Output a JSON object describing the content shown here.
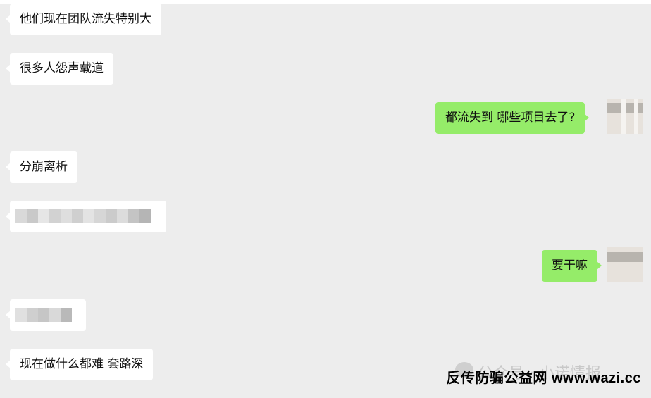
{
  "messages": [
    {
      "side": "left",
      "text": "他们现在团队流失特别大"
    },
    {
      "side": "left",
      "text": "很多人怨声载道"
    },
    {
      "side": "right",
      "text": "都流失到  哪些项目去了?"
    },
    {
      "side": "left",
      "text": "分崩离析"
    },
    {
      "side": "left",
      "text": "",
      "redacted": true
    },
    {
      "side": "right",
      "text": "要干嘛"
    },
    {
      "side": "left",
      "text": "",
      "redacted": true
    },
    {
      "side": "left",
      "text": "现在做什么都难 套路深"
    }
  ],
  "watermark": {
    "faint_text": "公众号 · 小诺情报",
    "main_text": "反传防骗公益网 www.wazi.cc"
  },
  "colors": {
    "background": "#ededed",
    "bubble_left": "#ffffff",
    "bubble_right": "#95ec69"
  }
}
